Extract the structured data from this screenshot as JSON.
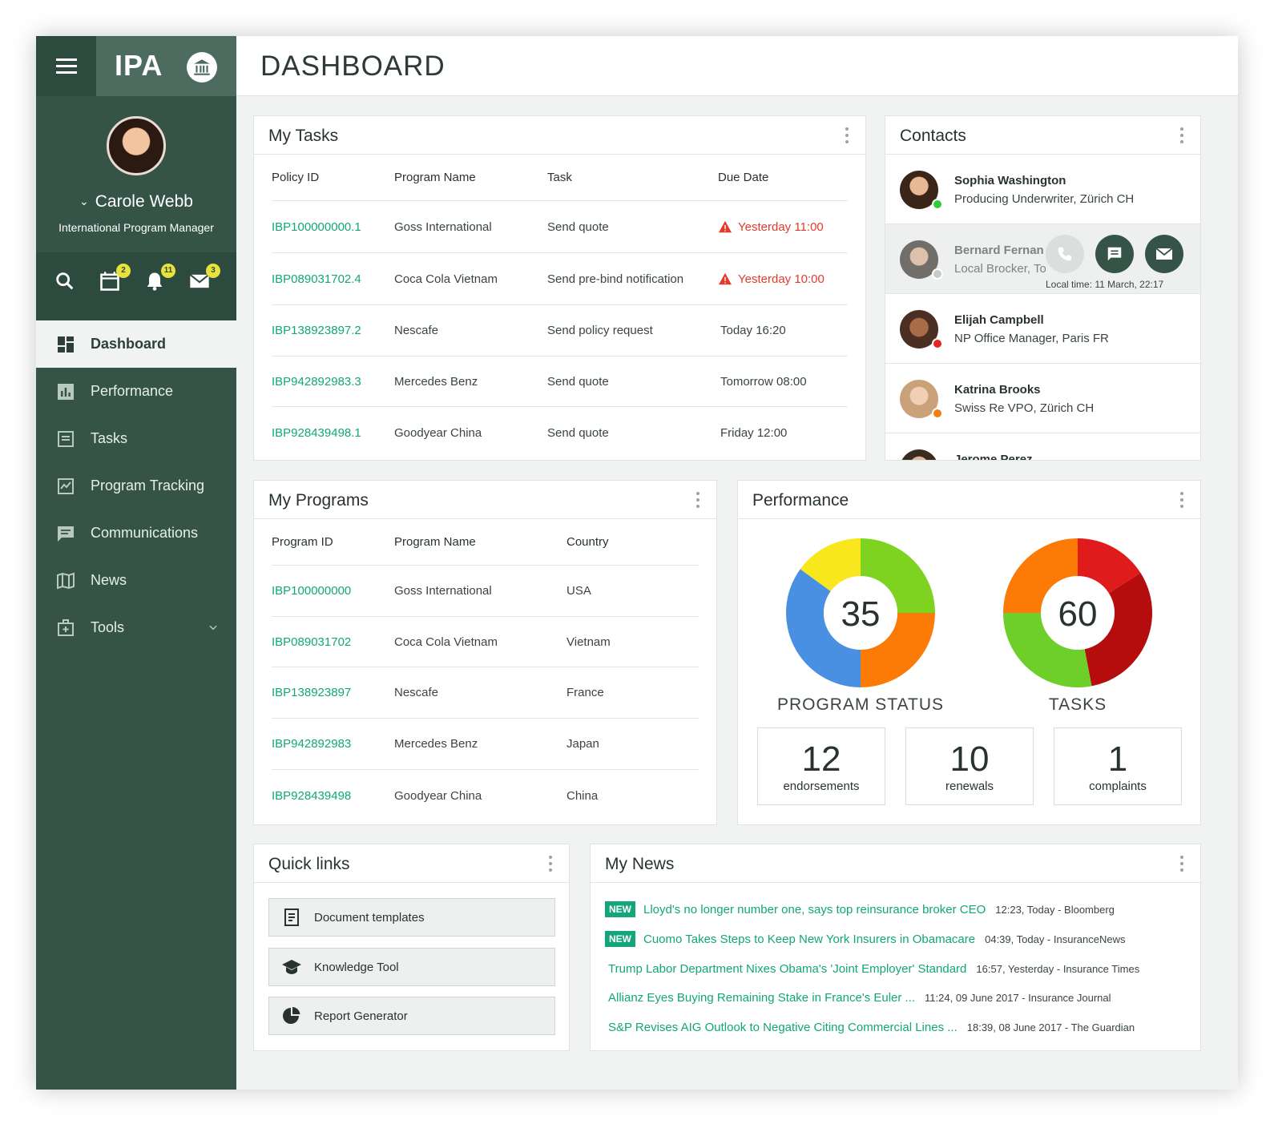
{
  "brand": {
    "name": "IPA"
  },
  "user": {
    "name": "Carole Webb",
    "role": "International Program Manager"
  },
  "toolbar": {
    "calendar_count": "2",
    "notification_count": "11",
    "mail_count": "3"
  },
  "nav": {
    "items": [
      {
        "label": "Dashboard"
      },
      {
        "label": "Performance"
      },
      {
        "label": "Tasks"
      },
      {
        "label": "Program Tracking"
      },
      {
        "label": "Communications"
      },
      {
        "label": "News"
      },
      {
        "label": "Tools"
      }
    ]
  },
  "page": {
    "title": "DASHBOARD"
  },
  "tasks": {
    "title": "My Tasks",
    "headers": [
      "Policy ID",
      "Program Name",
      "Task",
      "Due Date"
    ],
    "rows": [
      {
        "id": "IBP100000000.1",
        "program": "Goss International",
        "task": "Send quote",
        "due": "Yesterday 11:00"
      },
      {
        "id": "IBP089031702.4",
        "program": "Coca Cola Vietnam",
        "task": "Send pre-bind notification",
        "due": "Yesterday 10:00"
      },
      {
        "id": "IBP138923897.2",
        "program": "Nescafe",
        "task": "Send policy request",
        "due": "Today 16:20"
      },
      {
        "id": "IBP942892983.3",
        "program": "Mercedes Benz",
        "task": "Send quote",
        "due": "Tomorrow 08:00"
      },
      {
        "id": "IBP928439498.1",
        "program": "Goodyear China",
        "task": "Send quote",
        "due": "Friday 12:00"
      }
    ]
  },
  "contacts": {
    "title": "Contacts",
    "items": [
      {
        "name": "Sophia Washington",
        "role": "Producing Underwriter, Zürich CH",
        "status_color": "#2fcf3a"
      },
      {
        "name": "Bernard Fernan",
        "role": "Local Brocker, To",
        "status_color": "#c7cbc9",
        "local_time": "Local time: 11 March, 22:17"
      },
      {
        "name": "Elijah Campbell",
        "role": "NP Office Manager, Paris FR",
        "status_color": "#e8231f"
      },
      {
        "name": "Katrina Brooks",
        "role": "Swiss Re VPO, Zürich CH",
        "status_color": "#f57c11"
      },
      {
        "name": "Jerome Perez",
        "role": "",
        "status_color": "#c7cbc9"
      }
    ]
  },
  "programs": {
    "title": "My Programs",
    "headers": [
      "Program ID",
      "Program Name",
      "Country"
    ],
    "rows": [
      {
        "id": "IBP100000000",
        "program": "Goss International",
        "country": "USA"
      },
      {
        "id": "IBP089031702",
        "program": "Coca Cola Vietnam",
        "country": "Vietnam"
      },
      {
        "id": "IBP138923897",
        "program": "Nescafe",
        "country": "France"
      },
      {
        "id": "IBP942892983",
        "program": "Mercedes Benz",
        "country": "Japan"
      },
      {
        "id": "IBP928439498",
        "program": "Goodyear China",
        "country": "China"
      }
    ]
  },
  "performance": {
    "title": "Performance",
    "stats": [
      {
        "value": "12",
        "label": "endorsements"
      },
      {
        "value": "10",
        "label": "renewals"
      },
      {
        "value": "1",
        "label": "complaints"
      }
    ]
  },
  "chart_data": [
    {
      "type": "pie",
      "title": "PROGRAM STATUS",
      "center_value": "35",
      "slices": [
        {
          "value": 25,
          "color": "#7ed321"
        },
        {
          "value": 25,
          "color": "#fc7a06"
        },
        {
          "value": 35,
          "color": "#4a90e2"
        },
        {
          "value": 15,
          "color": "#f8e71c"
        }
      ]
    },
    {
      "type": "pie",
      "title": "TASKS",
      "center_value": "60",
      "slices": [
        {
          "value": 16,
          "color": "#e01b1b"
        },
        {
          "value": 31,
          "color": "#b50d0d"
        },
        {
          "value": 28,
          "color": "#6fcf2a"
        },
        {
          "value": 25,
          "color": "#fc7a06"
        }
      ]
    }
  ],
  "quick_links": {
    "title": "Quick links",
    "items": [
      {
        "label": "Document templates"
      },
      {
        "label": "Knowledge Tool"
      },
      {
        "label": "Report Generator"
      }
    ]
  },
  "news": {
    "title": "My News",
    "new_label": "NEW",
    "items": [
      {
        "is_new": true,
        "title": "Lloyd's no longer number one, says top reinsurance broker CEO",
        "meta": "12:23, Today - Bloomberg"
      },
      {
        "is_new": true,
        "title": "Cuomo Takes Steps to Keep New York Insurers in Obamacare",
        "meta": "04:39, Today - InsuranceNews"
      },
      {
        "is_new": false,
        "title": "Trump Labor Department Nixes Obama's 'Joint Employer' Standard",
        "meta": "16:57, Yesterday - Insurance Times"
      },
      {
        "is_new": false,
        "title": "Allianz Eyes Buying Remaining Stake in France's Euler ...",
        "meta": "11:24, 09 June 2017 - Insurance Journal"
      },
      {
        "is_new": false,
        "title": "S&P Revises AIG Outlook to Negative Citing Commercial Lines ...",
        "meta": "18:39, 08 June 2017 - The Guardian"
      }
    ]
  }
}
